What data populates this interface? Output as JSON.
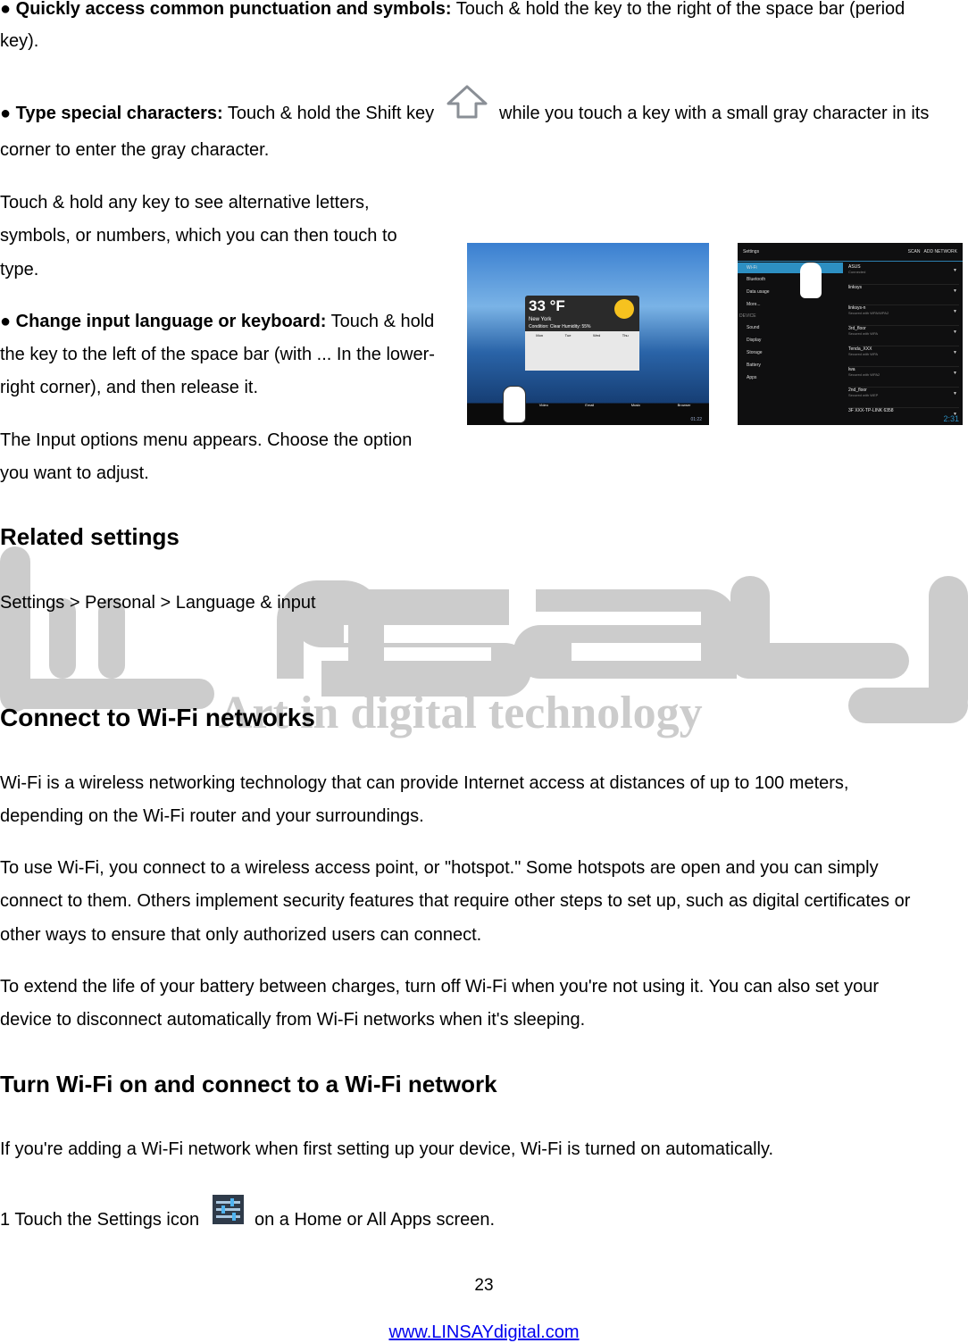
{
  "p1": {
    "bullet": "●",
    "bold": "Quickly access common punctuation and symbols:",
    "line1": " Touch & hold the key to the right of the space bar (period",
    "line2": "key)."
  },
  "p2": {
    "bullet": "●",
    "bold": "Type special characters:",
    "line1a": " Touch & hold the Shift key",
    "line1b": "while you touch a key with a small gray character in its",
    "line2": "corner to enter the gray character.",
    "icon": "shift-arrow-icon"
  },
  "p3": {
    "lines": [
      "Touch & hold any key to see alternative letters,",
      "symbols, or numbers, which you can then touch to",
      "type."
    ]
  },
  "p4": {
    "bullet": "●",
    "bold": "Change input language or keyboard:",
    "line1": " Touch & hold",
    "lines": [
      "the key to the left of the space bar (with ... In the lower-",
      "right corner), and then release it."
    ]
  },
  "p5": {
    "lines": [
      "The Input options menu appears. Choose the option",
      "you want to adjust."
    ]
  },
  "related": {
    "heading": "Related settings",
    "path": "Settings > Personal > Language & input"
  },
  "watermark": {
    "logo": "linsay",
    "tagline": "Art in digital technology",
    "color": "#cccccc"
  },
  "wifi": {
    "heading": "Connect to Wi-Fi networks",
    "para1": [
      "Wi-Fi is a wireless networking technology that can provide Internet access at distances of up to 100 meters,",
      "depending on the Wi-Fi router and your surroundings."
    ],
    "para2": [
      "To use Wi-Fi, you connect to a wireless access point, or \"hotspot.\" Some hotspots are open and you can simply",
      "connect to them. Others implement security features that require other steps to set up, such as digital certificates or",
      "other ways to ensure that only authorized users can connect."
    ],
    "para3": [
      "To extend the life of your battery between charges, turn off Wi-Fi when you're not using it. You can also set your",
      "device to disconnect automatically from Wi-Fi networks when it's sleeping."
    ]
  },
  "turn_on": {
    "heading": "Turn Wi-Fi on and connect to a Wi-Fi network",
    "para1": "If you're adding a Wi-Fi network when first setting up your device, Wi-Fi is turned on automatically.",
    "step1a": "1 Touch the Settings icon",
    "step1b": "on a Home or All Apps screen.",
    "icon": "settings-sliders-icon"
  },
  "screens": {
    "home": {
      "temp": "33 °F",
      "city": "New York",
      "condition": "Condition: Clear Humidity: 55%",
      "days": [
        "Mon",
        "Tue",
        "Wed",
        "Thu"
      ],
      "dock": [
        "Video",
        "Email",
        "Music",
        "Browser"
      ],
      "clock": "01:22"
    },
    "settings": {
      "title": "Settings",
      "actions": [
        "SCAN",
        "ADD NETWORK"
      ],
      "menu": [
        "Wi-Fi",
        "Bluetooth",
        "Data usage",
        "More...",
        "DEVICE",
        "Sound",
        "Display",
        "Storage",
        "Battery",
        "Apps"
      ],
      "networks": [
        {
          "name": "ASUS",
          "status": "Connected"
        },
        {
          "name": "linksys",
          "status": ""
        },
        {
          "name": "linksys-n",
          "status": "Secured with WPA/WPA2"
        },
        {
          "name": "3rd_floor",
          "status": "Secured with WPA"
        },
        {
          "name": "Tenda_XXX",
          "status": "Secured with WPA"
        },
        {
          "name": "lwa",
          "status": "Secured with WPA2"
        },
        {
          "name": "2nd_floor",
          "status": "Secured with WEP"
        },
        {
          "name": "3F XXX-TP-LINK 6358",
          "status": ""
        }
      ],
      "clock": "2:31"
    }
  },
  "footer": {
    "page": "23",
    "link": "www.LINSAYdigital.com"
  }
}
